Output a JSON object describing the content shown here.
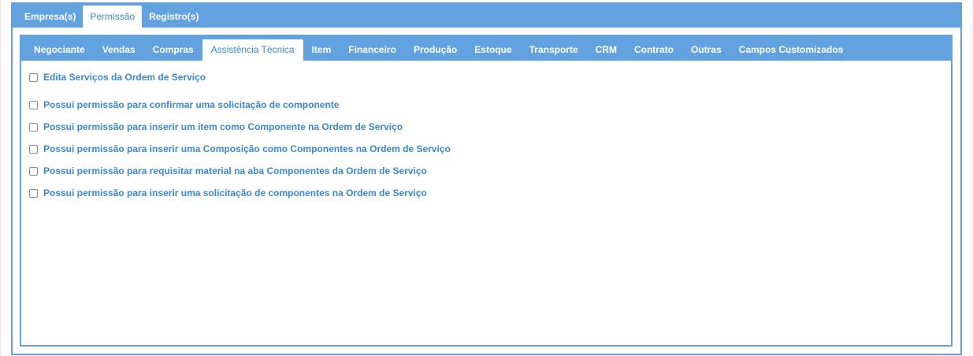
{
  "outer_tabs": [
    {
      "label": "Empresa(s)",
      "active": false
    },
    {
      "label": "Permissão",
      "active": true
    },
    {
      "label": "Registro(s)",
      "active": false
    }
  ],
  "inner_tabs": [
    {
      "label": "Negociante",
      "active": false
    },
    {
      "label": "Vendas",
      "active": false
    },
    {
      "label": "Compras",
      "active": false
    },
    {
      "label": "Assistência Técnica",
      "active": true
    },
    {
      "label": "Item",
      "active": false
    },
    {
      "label": "Financeiro",
      "active": false
    },
    {
      "label": "Produção",
      "active": false
    },
    {
      "label": "Estoque",
      "active": false
    },
    {
      "label": "Transporte",
      "active": false
    },
    {
      "label": "CRM",
      "active": false
    },
    {
      "label": "Contrato",
      "active": false
    },
    {
      "label": "Outras",
      "active": false
    },
    {
      "label": "Campos Customizados",
      "active": false
    }
  ],
  "permissions": [
    {
      "label": "Edita Serviços da Ordem de Serviço",
      "checked": false
    },
    {
      "label": "Possui permissão para confirmar uma solicitação de componente",
      "checked": false
    },
    {
      "label": "Possui permissão para inserir um item como Componente na Ordem de Serviço",
      "checked": false
    },
    {
      "label": "Possui permissão para inserir uma Composição como Componentes na Ordem de Serviço",
      "checked": false
    },
    {
      "label": "Possui permissão para requisitar material na aba Componentes da Ordem de Serviço",
      "checked": false
    },
    {
      "label": "Possui permissão para inserir uma solicitação de componentes na Ordem de Serviço",
      "checked": false
    }
  ],
  "colors": {
    "accent": "#63a2e0",
    "link_text": "#3a87d1"
  }
}
